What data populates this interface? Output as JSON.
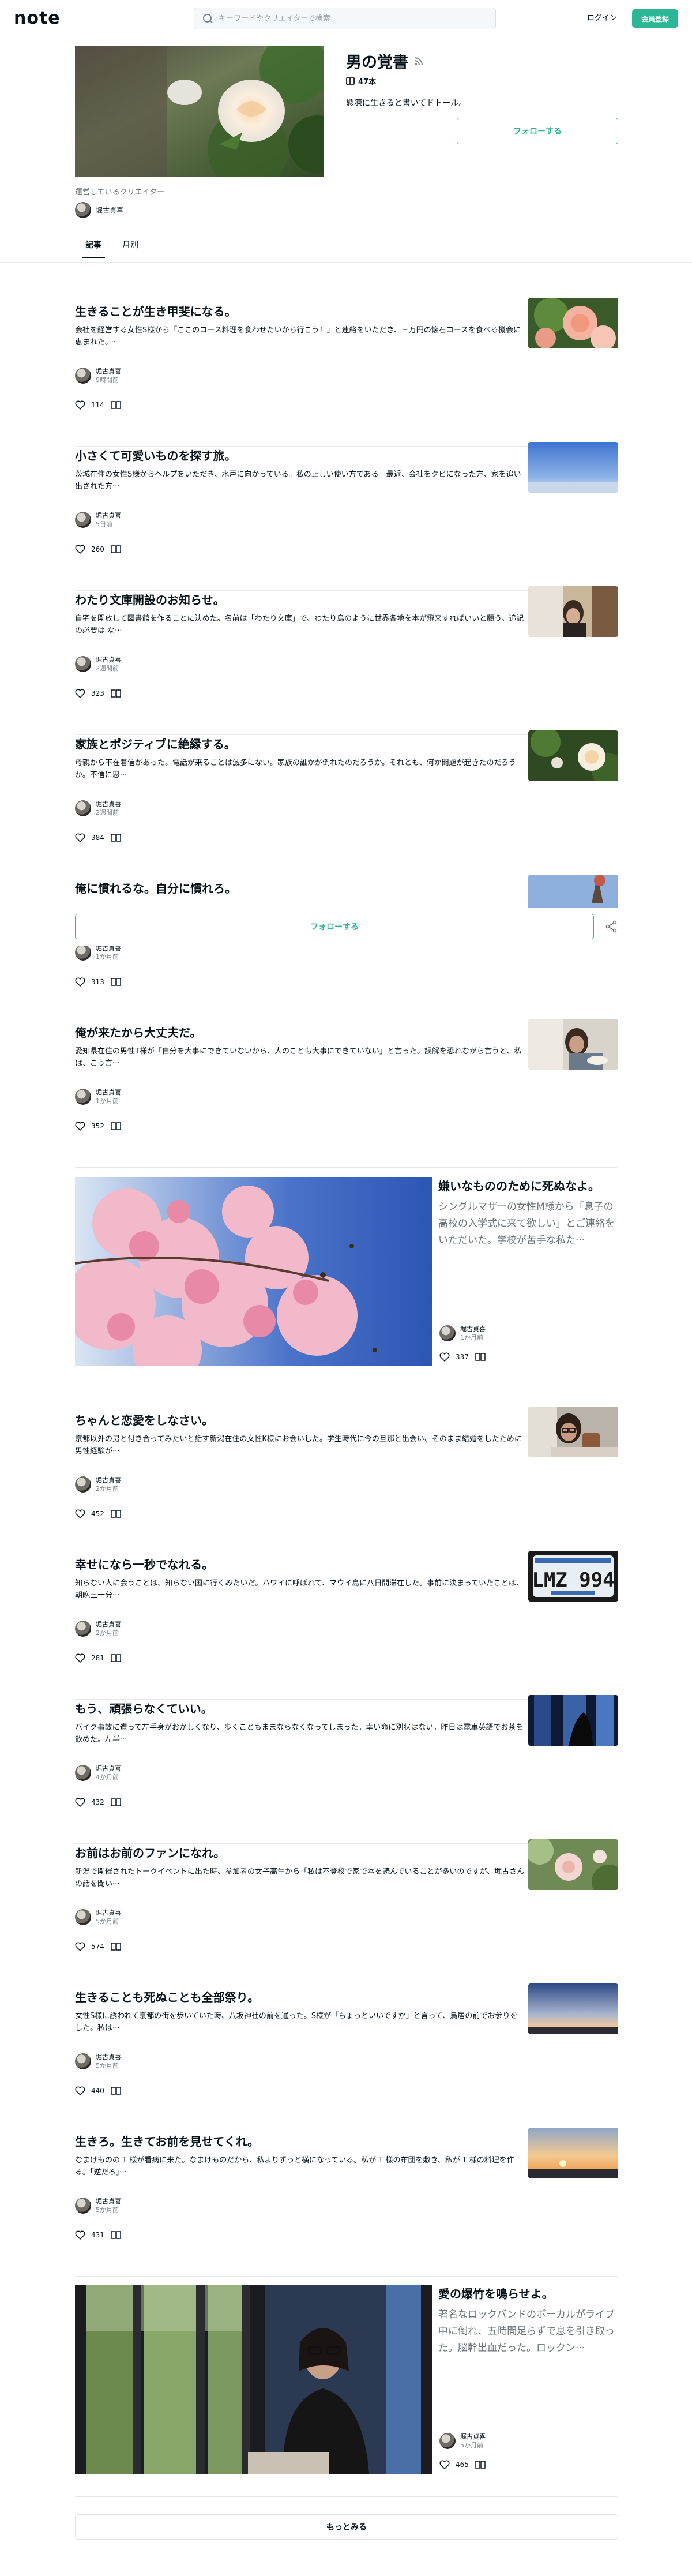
{
  "header": {
    "logo": "note",
    "search_placeholder": "キーワードやクリエイターで検索",
    "login_label": "ログイン",
    "signup_label": "会員登録"
  },
  "magazine": {
    "title": "男の覚書",
    "article_count": "47本",
    "description": "懸凍に生きると書いてドトール。",
    "follow_label": "フォローする",
    "operator_label": "運営しているクリエイター",
    "operator_name": "堀古貞喜"
  },
  "tabs": [
    {
      "label": "記事",
      "active": true
    },
    {
      "label": "月別",
      "active": false
    }
  ],
  "articles": [
    {
      "title": "生きることが生き甲斐になる。",
      "excerpt": "会社を経営する女性S様から「ここのコース料理を食わせたいから行こう！」と連絡をいただき、三万円の懐石コースを食べる機会に恵まれた。···",
      "author": "堀古貞喜",
      "time": "9時間前",
      "likes": "114",
      "thumb": "rose-pink"
    },
    {
      "title": "小さくて可愛いものを探す旅。",
      "excerpt": "茨城在住の女性S様からヘルプをいただき、水戸に向かっている。私の正しい使い方である。最近、会社をクビになった方、家を追い出された方···",
      "author": "堀古貞喜",
      "time": "5日前",
      "likes": "260",
      "thumb": "sky"
    },
    {
      "title": "わたり文庫開設のお知らせ。",
      "excerpt": "自宅を開放して図書館を作ることに決めた。名前は「わたり文庫」で、わたり鳥のように世界各地を本が飛来すればいいと願う。追記の必要は な···",
      "author": "堀古貞喜",
      "time": "2週間前",
      "likes": "323",
      "thumb": "window"
    },
    {
      "title": "家族とポジティブに絶縁する。",
      "excerpt": "母親から不在着信があった。電話が来ることは滅多にない。家族の誰かが倒れたのだろうか。それとも、何か問題が起きたのだろうか。不信に思···",
      "author": "堀古貞喜",
      "time": "2週間前",
      "likes": "384",
      "thumb": "rose-white"
    },
    {
      "title": "俺に慣れるな。自分に慣れろ。",
      "excerpt": "",
      "author": "堀古貞喜",
      "time": "1か月前",
      "likes": "313",
      "thumb": "sky-tree"
    },
    {
      "title": "俺が来たから大丈夫だ。",
      "excerpt": "愛知県在住の男性T様が「自分を大事にできていないから、人のことも大事にできていない」と言った。誤解を恐れながら言うと、私は、こう言···",
      "author": "堀古貞喜",
      "time": "1か月前",
      "likes": "352",
      "thumb": "eating"
    }
  ],
  "featured_1": {
    "title": "嫌いなもののために死ぬなよ。",
    "excerpt": "シングルマザーの女性M様から「息子の高校の入学式に来て欲しい」とご連絡をいただいた。学校が苦手な私た···",
    "author": "堀古貞喜",
    "time": "1か月前",
    "likes": "337"
  },
  "articles_2": [
    {
      "title": "ちゃんと恋愛をしなさい。",
      "excerpt": "京都以外の男と付き合ってみたいと話す新潟在住の女性K様にお会いした。学生時代に今の旦那と出会い、そのまま結婚をしたために男性経験が···",
      "author": "堀古貞喜",
      "time": "2か月前",
      "likes": "452",
      "thumb": "cup"
    },
    {
      "title": "幸せになら一秒でなれる。",
      "excerpt": "知らない人に会うことは、知らない国に行くみたいだ。ハワイに呼ばれて、マウイ島に八日間滞在した。事前に決まっていたことは、朝晩三十分···",
      "author": "堀古貞喜",
      "time": "2か月前",
      "likes": "281",
      "thumb": "plate"
    },
    {
      "title": "もう、頑張らなくていい。",
      "excerpt": "バイク事故に遭って左手身がおかしくなり、歩くこともままならなくなってしまった。幸い命に別状はない。昨日は電車英語でお茶を飲めた。左半···",
      "author": "堀古貞喜",
      "time": "4か月前",
      "likes": "432",
      "thumb": "dark-window"
    },
    {
      "title": "お前はお前のファンになれ。",
      "excerpt": "新潟で開催されたトークイベントに出た時、参加者の女子高生から「私は不登校で家で本を読んでいることが多いのですが、堀古さんの話を聞い···",
      "author": "堀古貞喜",
      "time": "5か月前",
      "likes": "574",
      "thumb": "rose-light"
    },
    {
      "title": "生きることも死ぬことも全部祭り。",
      "excerpt": "女性S様に誘われて京都の街を歩いていた時、八坂神社の前を通った。S様が「ちょっといいですか」と言って、鳥居の前でお参りをした。私は···",
      "author": "堀古貞喜",
      "time": "5か月前",
      "likes": "440",
      "thumb": "dusk"
    },
    {
      "title": "生きろ。生きてお前を見せてくれ。",
      "excerpt": "なまけものの T 様が看病に来た。なまけものだから、私よりずっと横になっている。私が T 様の布団を敷き、私が T 様の料理を作る。「逆だろ」···",
      "author": "堀古貞喜",
      "time": "5か月前",
      "likes": "431",
      "thumb": "sunset"
    }
  ],
  "featured_2": {
    "title": "愛の爆竹を鳴らせよ。",
    "excerpt": "著名なロックバンドのボーカルがライブ中に倒れ、五時間足らずで息を引き取った。脳幹出血だった。ロックン···",
    "author": "堀古貞喜",
    "time": "5か月前",
    "likes": "465"
  },
  "floating_follow_label": "フォローする",
  "more_label": "もっとみる",
  "colors": {
    "accent": "#2cb696",
    "text": "#08131a"
  }
}
